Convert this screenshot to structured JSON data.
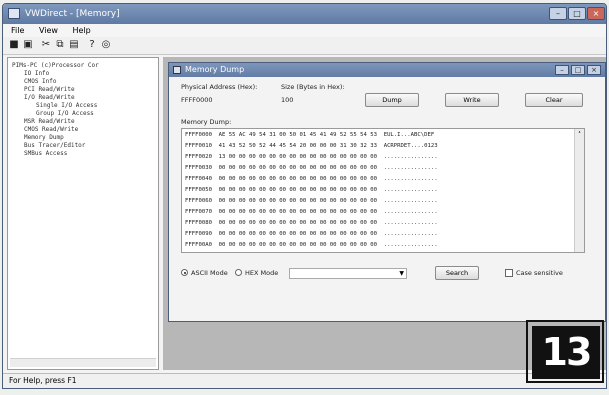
{
  "window": {
    "title": "VWDirect - [Memory]"
  },
  "menu": [
    "File",
    "View",
    "Help"
  ],
  "toolbar": [
    {
      "name": "save-icon",
      "glyph": "■"
    },
    {
      "name": "save-all-icon",
      "glyph": "▣"
    },
    {
      "name": "cut-icon",
      "glyph": "✂"
    },
    {
      "name": "copy-icon",
      "glyph": "⧉"
    },
    {
      "name": "paste-icon",
      "glyph": "▤"
    },
    {
      "name": "help-icon",
      "glyph": "?"
    },
    {
      "name": "about-icon",
      "glyph": "◎"
    }
  ],
  "tree": [
    "PIMs-PC (c)Processor Cor",
    "IO Info",
    "CMOS Info",
    "PCI Read/Write",
    "I/O Read/Write",
    "Single I/O Access",
    "Group I/O Access",
    "MSR Read/Write",
    "CMOS Read/Write",
    "Memory Dump",
    "Bus Tracer/Editor",
    "SMBus Access"
  ],
  "memory": {
    "title": "Memory Dump",
    "physical_address_label": "Physical Address (Hex):",
    "physical_address_value": "FFFF0000",
    "size_label": "Size (Bytes in Hex):",
    "size_value": "100",
    "dump_button": "Dump",
    "write_button": "Write",
    "clear_button": "Clear",
    "memory_dump_label": "Memory Dump:",
    "rows": [
      "FFFF0000  AE 55 AC 49 54 31 00 50 01 45 41 49 52 55 54 53  EUL.I...ABC\\DEF",
      "FFFF0010  41 43 52 50 52 44 45 54 20 00 00 00 31 30 32 33  ACRPRDET....0123",
      "FFFF0020  13 00 00 00 00 00 00 00 00 00 00 00 00 00 00 00  ................",
      "FFFF0030  00 00 00 00 00 00 00 00 00 00 00 00 00 00 00 00  ................",
      "FFFF0040  00 00 00 00 00 00 00 00 00 00 00 00 00 00 00 00  ................",
      "FFFF0050  00 00 00 00 00 00 00 00 00 00 00 00 00 00 00 00  ................",
      "FFFF0060  00 00 00 00 00 00 00 00 00 00 00 00 00 00 00 00  ................",
      "FFFF0070  00 00 00 00 00 00 00 00 00 00 00 00 00 00 00 00  ................",
      "FFFF0080  00 00 00 00 00 00 00 00 00 00 00 00 00 00 00 00  ................",
      "FFFF0090  00 00 00 00 00 00 00 00 00 00 00 00 00 00 00 00  ................",
      "FFFF00A0  00 00 00 00 00 00 00 00 00 00 00 00 00 00 00 00  ................"
    ],
    "ascii_mode": "ASCII Mode",
    "hex_mode": "HEX Mode",
    "search_button": "Search",
    "case_sensitive": "Case sensitive"
  },
  "status": "For Help, press F1",
  "figure_badge": "13"
}
